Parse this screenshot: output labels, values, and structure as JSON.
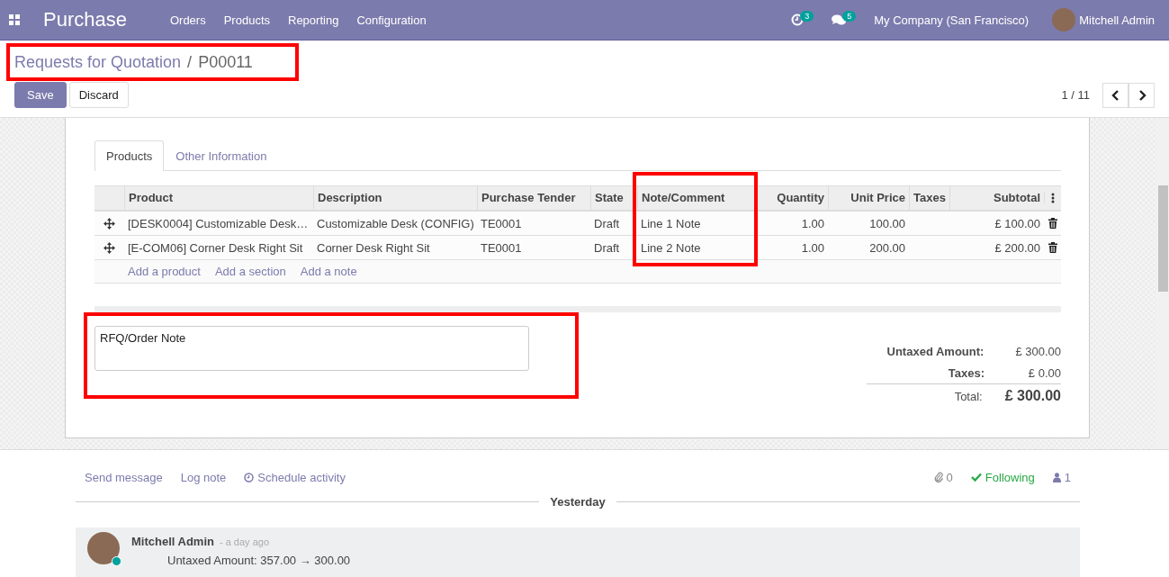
{
  "navbar": {
    "app_name": "Purchase",
    "menu": [
      "Orders",
      "Products",
      "Reporting",
      "Configuration"
    ],
    "activity_count": "3",
    "message_count": "5",
    "company": "My Company (San Francisco)",
    "user": "Mitchell Admin"
  },
  "breadcrumb": {
    "parent": "Requests for Quotation",
    "separator": "/",
    "current": "P00011"
  },
  "buttons": {
    "save": "Save",
    "discard": "Discard"
  },
  "pager": {
    "value": "1 / 11"
  },
  "tabs": [
    {
      "label": "Products",
      "selected": true
    },
    {
      "label": "Other Information",
      "selected": false
    }
  ],
  "table": {
    "columns": [
      "Product",
      "Description",
      "Purchase Tender",
      "State",
      "Note/Comment",
      "Quantity",
      "Unit Price",
      "Taxes",
      "Subtotal"
    ],
    "rows": [
      {
        "cells": [
          "[DESK0004] Customizable Desk…",
          "Customizable Desk (CONFIG)",
          "TE0001",
          "Draft",
          "Line 1 Note",
          "1.00",
          "100.00",
          "",
          "£ 100.00"
        ]
      },
      {
        "cells": [
          "[E-COM06] Corner Desk Right Sit",
          "Corner Desk Right Sit",
          "TE0001",
          "Draft",
          "Line 2 Note",
          "1.00",
          "200.00",
          "",
          "£ 200.00"
        ]
      }
    ],
    "add_links": [
      "Add a product",
      "Add a section",
      "Add a note"
    ]
  },
  "note_field": {
    "value": "RFQ/Order Note"
  },
  "totals": {
    "untaxed_label": "Untaxed Amount:",
    "untaxed_value": "£ 300.00",
    "taxes_label": "Taxes:",
    "taxes_value": "£ 0.00",
    "total_label": "Total:",
    "total_value": "£ 300.00"
  },
  "chatter": {
    "send_message": "Send message",
    "log_note": "Log note",
    "schedule_activity": "Schedule activity",
    "attachments": "0",
    "following": "Following",
    "followers": "1",
    "date_separator": "Yesterday",
    "message": {
      "author": "Mitchell Admin",
      "time": "- a day ago",
      "body": "Untaxed Amount: 357.00 → 300.00"
    }
  }
}
